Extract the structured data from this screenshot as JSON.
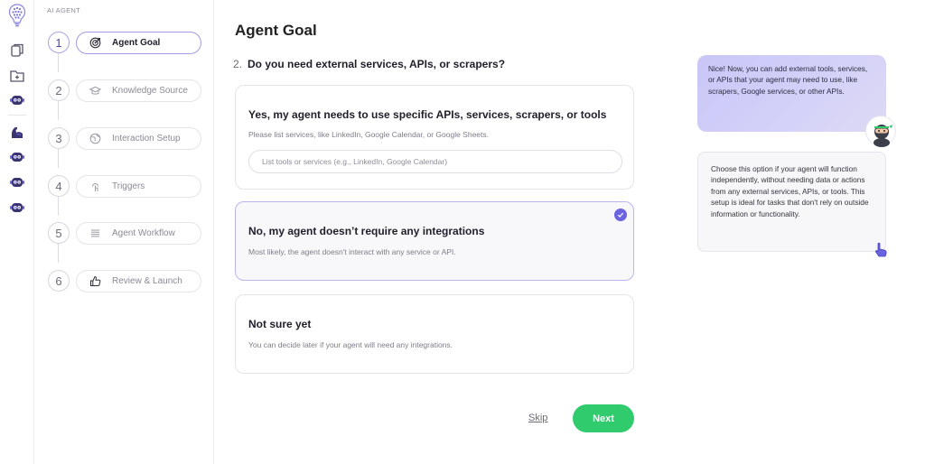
{
  "sidebar_label": "AI AGENT",
  "rail_icons": [
    "bulb-logo-icon",
    "layers-icon",
    "folder-add-icon",
    "robot-head-icon",
    "arm-icon",
    "robot-head-icon",
    "robot-head-icon",
    "robot-head-icon"
  ],
  "steps": [
    {
      "num": "1",
      "label": "Agent Goal",
      "icon": "target-icon",
      "active": true
    },
    {
      "num": "2",
      "label": "Knowledge Source",
      "icon": "graduation-cap-icon",
      "active": false
    },
    {
      "num": "3",
      "label": "Interaction Setup",
      "icon": "globe-icon",
      "active": false
    },
    {
      "num": "4",
      "label": "Triggers",
      "icon": "pointer-click-icon",
      "active": false
    },
    {
      "num": "5",
      "label": "Agent Workflow",
      "icon": "list-icon",
      "active": false
    },
    {
      "num": "6",
      "label": "Review & Launch",
      "icon": "thumbs-up-icon",
      "active": false
    }
  ],
  "main": {
    "title": "Agent Goal",
    "question_number": "2.",
    "question": "Do you need external services, APIs, or scrapers?",
    "options": [
      {
        "title": "Yes, my agent needs to use specific APIs, services, scrapers, or tools",
        "description": "Please list services, like LinkedIn, Google Calendar, or Google Sheets.",
        "input_placeholder": "List tools or services (e.g., LinkedIn, Google Calendar)",
        "input_value": "",
        "selected": false
      },
      {
        "title": "No, my agent doesn’t require any integrations",
        "description": "Most likely, the agent doesn't interact with any service or API.",
        "selected": true
      },
      {
        "title": "Not sure yet",
        "description": "You can decide later if your agent will need any integrations.",
        "selected": false
      }
    ],
    "skip_label": "Skip",
    "next_label": "Next"
  },
  "assistant": {
    "message": "Nice! Now, you can add external tools, services, or APIs that your agent may need to use, like scrapers, Google services, or other APIs.",
    "hint": "Choose this option if your agent will function independently, without needing data or actions from any external services, APIs, or tools. This setup is ideal for tasks that don't rely on outside information or functionality."
  },
  "colors": {
    "accent": "#6b63e0",
    "next_button": "#2fcb6c",
    "assistant_bubble": "#c9c6f7",
    "selected_border": "#b9b6ee"
  }
}
